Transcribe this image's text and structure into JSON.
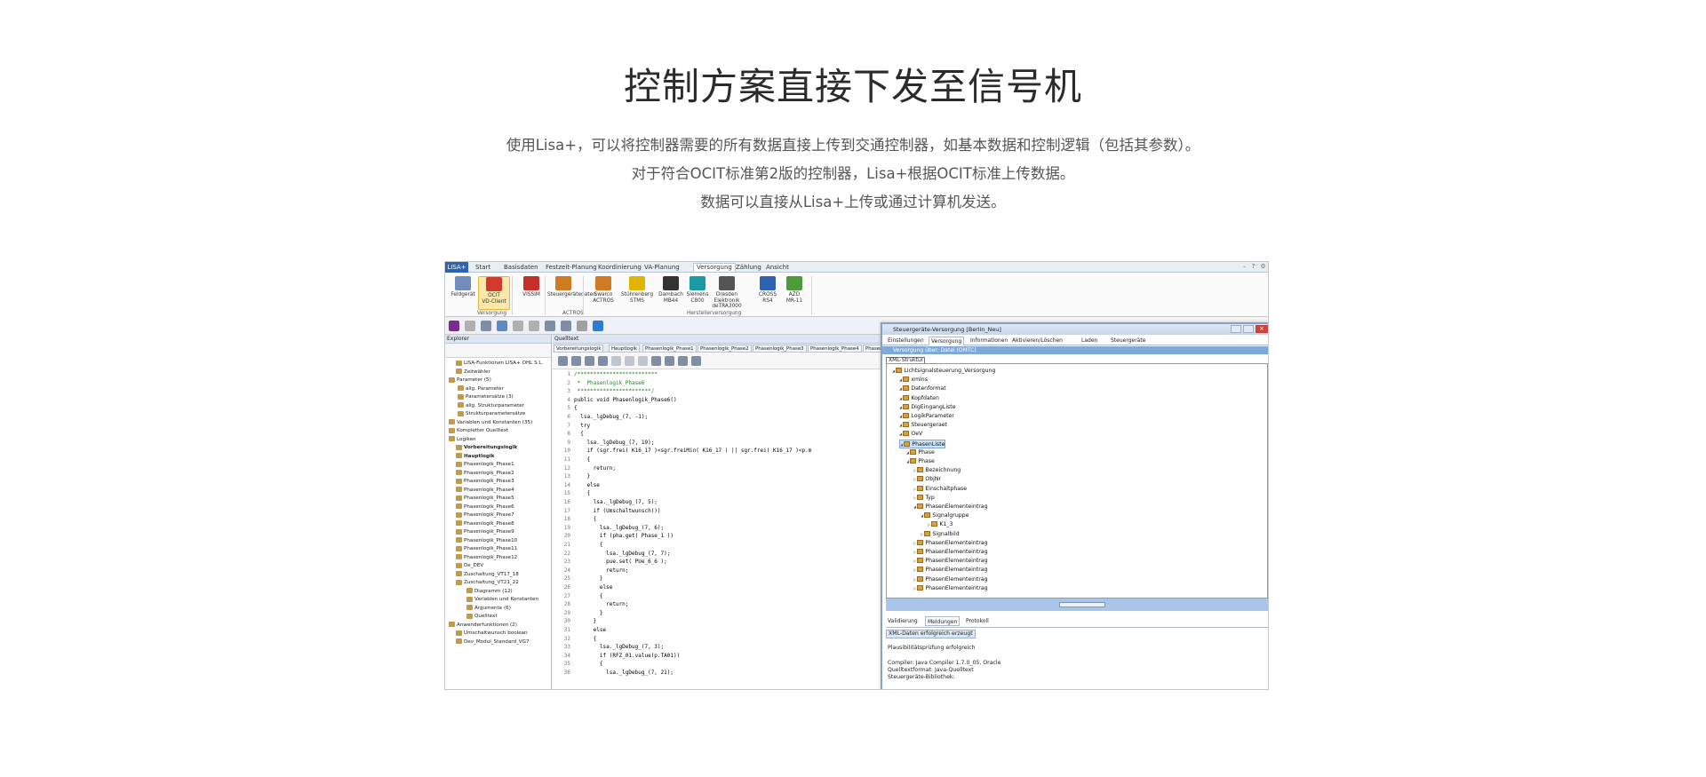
{
  "hero": {
    "title": "控制方案直接下发至信号机",
    "desc1": "使用Lisa+，可以将控制器需要的所有数据直接上传到交通控制器，如基本数据和控制逻辑（包括其参数）。",
    "desc2": "对于符合OCIT标准第2版的控制器，Lisa+根据OCIT标准上传数据。",
    "desc3": "数据可以直接从Lisa+上传或通过计算机发送。"
  },
  "app": {
    "app_button": "LISA+",
    "tabs": [
      "Start",
      "Basisdaten",
      "Festzeit-Planung",
      "Koordinierung",
      "VA-Planung",
      "Versorgung",
      "Zählung",
      "Ansicht"
    ],
    "active_tab": "Versorgung",
    "ribbon_buttons": [
      {
        "label": "Feldgerät",
        "color": "#6f8db8"
      },
      {
        "label": "OCIT\nVD-Client",
        "color": "#d3392c"
      },
      {
        "label": "VISSIM",
        "color": "#c7302a"
      },
      {
        "label": "Steuergerätedaten",
        "color": "#d07a22"
      },
      {
        "label": "Swarco\nACTROS",
        "color": "#d07a22"
      },
      {
        "label": "Stührenberg\nSTMS",
        "color": "#e0b400"
      },
      {
        "label": "Dambach\nMB44",
        "color": "#333333"
      },
      {
        "label": "Siemens\nC800",
        "color": "#1a9aa6"
      },
      {
        "label": "Dresden Elektronik\ndeTRA3000",
        "color": "#555555"
      },
      {
        "label": "CROSS\nRS4",
        "color": "#2e62b3"
      },
      {
        "label": "AŽD\nMR-11",
        "color": "#4c9a3a"
      }
    ],
    "ribbon_groups": [
      "Versorgung",
      "ACTROS",
      "Herstellerversorgung"
    ],
    "explorer": {
      "title": "Explorer",
      "items": [
        "LISA-Funktionen  LISA+ OHL S.L.",
        "Zeitwähler",
        "Parameter  (5)",
        "allg. Parameter",
        "Parametersätze  (3)",
        "allg. Strukturparameter",
        "Strukturparametersätze",
        "Variablen und Konstanten  (35)",
        "Kompletter Quelltext",
        "Logiken",
        "Vorbereitungslogik",
        "Hauptlogik",
        "Phasenlogik_Phase1",
        "Phasenlogik_Phase2",
        "Phasenlogik_Phase3",
        "Phasenlogik_Phase4",
        "Phasenlogik_Phase5",
        "Phasenlogik_Phase6",
        "Phasenlogik_Phase7",
        "Phasenlogik_Phase8",
        "Phasenlogik_Phase9",
        "Phasenlogik_Phase10",
        "Phasenlogik_Phase11",
        "Phasenlogik_Phase12",
        "De_DEV",
        "Zuschaltung_VT17_18",
        "Zuschaltung_VT21_22",
        "Diagramm  (12)",
        "Variablen und Konstanten",
        "Argumente  (6)",
        "Quelltext",
        "Anwenderfunktionen  (2)",
        "Umschaltwunsch  boolean",
        "Dev_Modul_Standard_VG7"
      ]
    },
    "editor": {
      "title": "Quelltext",
      "tabs": [
        "Vorbereitungslogik",
        "Hauptlogik",
        "Phasenlogik_Phase1",
        "Phasenlogik_Phase2",
        "Phasenlogik_Phase3",
        "Phasenlogik_Phase4",
        "Phasenlogik_Phase5",
        "Phasenl"
      ],
      "lines": [
        "/*************************",
        " *  Phasenlogik_Phase6",
        " ***********************/",
        "public void Phasenlogik_Phase6()",
        "{",
        "  lsa._lgDebug_(7, -1);",
        "  try",
        "  {",
        "    lsa._lgDebug_(7, 19);",
        "    if (sgr.frei( K16_17 )<sgr.freiMin( K16_17 ) || sgr.frei( K16_17 )<p.m",
        "    {",
        "      return;",
        "    }",
        "    else",
        "    {",
        "      lsa._lgDebug_(7, 5);",
        "      if (Umschaltwunsch())",
        "      {",
        "        lsa._lgDebug_(7, 6);",
        "        if (pha.get( Phase_1 ))",
        "        {",
        "          lsa._lgDebug_(7, 7);",
        "          pue.set( PUe_6_6 );",
        "          return;",
        "        }",
        "        else",
        "        {",
        "          return;",
        "        }",
        "      }",
        "      else",
        "      {",
        "        lsa._lgDebug_(7, 3);",
        "        if (RFZ_01.value(p.TA01))",
        "        {",
        "          lsa._lgDebug_(7, 21);"
      ]
    },
    "dialog": {
      "title": "Steuergeräte-Versorgung [Berlin_Neu]",
      "tabs": [
        "Einstellungen",
        "Versorgung",
        "Informationen",
        "Aktivieren/Löschen",
        "Laden",
        "Steuergeräte"
      ],
      "active_tab": "Versorgung",
      "subheader": "Versorgung über: Datei (OMTC)",
      "xml_label": "XML-Struktur",
      "tree": [
        {
          "label": "Lichtsignalsteuerung_Versorgung",
          "lvl": 0
        },
        {
          "label": "xmlns",
          "lvl": 1
        },
        {
          "label": "Datenformat",
          "lvl": 1
        },
        {
          "label": "Kopfdaten",
          "lvl": 1
        },
        {
          "label": "DigEingangListe",
          "lvl": 1
        },
        {
          "label": "LogikParameter",
          "lvl": 1
        },
        {
          "label": "Steuergeraet",
          "lvl": 1
        },
        {
          "label": "OeV",
          "lvl": 1
        },
        {
          "label": "PhasenListe",
          "lvl": 1,
          "hl": true
        },
        {
          "label": "Phase",
          "lvl": 2
        },
        {
          "label": "Phase",
          "lvl": 2
        },
        {
          "label": "Bezeichnung",
          "lvl": 3
        },
        {
          "label": "ObjNr",
          "lvl": 3
        },
        {
          "label": "Einschaltphase",
          "lvl": 3
        },
        {
          "label": "Typ",
          "lvl": 3
        },
        {
          "label": "PhasenElementeintrag",
          "lvl": 3
        },
        {
          "label": "Signalgruppe",
          "lvl": 4
        },
        {
          "label": "K1_3",
          "lvl": 5
        },
        {
          "label": "Signalbild",
          "lvl": 4
        },
        {
          "label": "PhasenElementeintrag",
          "lvl": 3
        },
        {
          "label": "PhasenElementeintrag",
          "lvl": 3
        },
        {
          "label": "PhasenElementeintrag",
          "lvl": 3
        },
        {
          "label": "PhasenElementeintrag",
          "lvl": 3
        },
        {
          "label": "PhasenElementeintrag",
          "lvl": 3
        },
        {
          "label": "PhasenElementeintrag",
          "lvl": 3
        }
      ],
      "bottom_tabs": [
        "Validierung",
        "Meldungen",
        "Protokoll"
      ],
      "bottom_active": "Meldungen",
      "messages": [
        "XML-Daten erfolgreich erzeugt",
        "",
        "Plausibilitätsprüfung erfolgreich",
        "",
        "Compiler: Java Compiler 1.7.0_05, Oracle",
        "Quelltextformat: Java-Quelltext",
        "Steuergeräte-Bibliothek:"
      ]
    }
  }
}
